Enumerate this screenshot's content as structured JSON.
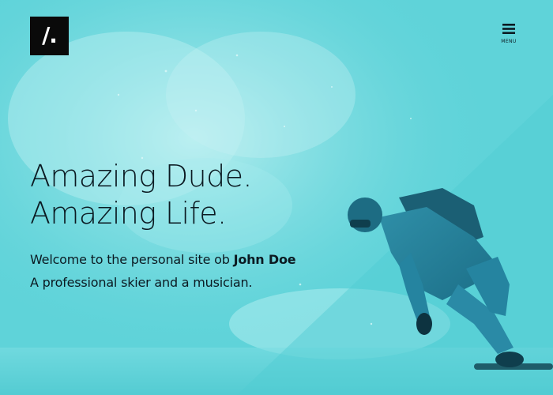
{
  "brand": {
    "logo_text": "/.",
    "logo_bg": "#0a0a0a",
    "logo_fg": "#ffffff"
  },
  "nav": {
    "menu_label": "MENU",
    "menu_icon": "hamburger-icon"
  },
  "hero": {
    "headline_line1": "Amazing Dude.",
    "headline_line2": "Amazing Life.",
    "intro_prefix": "Welcome to the personal site ob ",
    "intro_name": "John Doe",
    "description": "A professional skier and a musician.",
    "background_photo": "snowboarder-in-powder",
    "tint_color": "#5fd3d9"
  }
}
